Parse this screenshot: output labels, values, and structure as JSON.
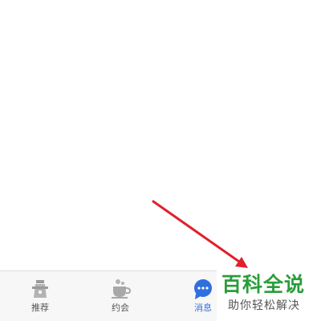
{
  "tabbar": {
    "tabs": [
      {
        "label": "推荐",
        "icon": "lighthouse-icon",
        "active": false
      },
      {
        "label": "约会",
        "icon": "coffee-cup-icon",
        "active": false
      },
      {
        "label": "消息",
        "icon": "chat-bubble-icon",
        "active": true
      }
    ]
  },
  "watermark": {
    "title": "百科全说",
    "subtitle": "助你轻松解决"
  },
  "colors": {
    "active_tab": "#2f6fe0",
    "inactive_tab": "#555555",
    "arrow": "#e0202a",
    "watermark_green": "#2a9d3a"
  }
}
